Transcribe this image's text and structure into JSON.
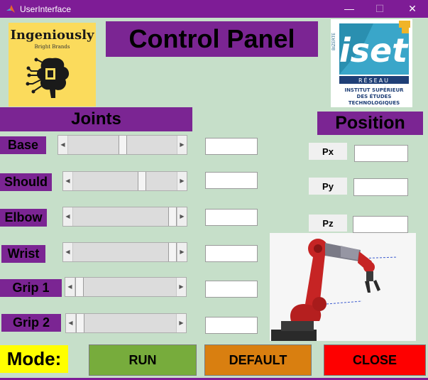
{
  "window": {
    "title": "UserInterface",
    "minimize_symbol": "—",
    "maximize_symbol": "☐",
    "close_symbol": "✕",
    "icon": "matlab-icon"
  },
  "header": {
    "title": "Control Panel"
  },
  "logo_left": {
    "name": "Ingeniously",
    "tagline": "Bright Brands"
  },
  "logo_right": {
    "big": "iset",
    "side": "BIZERTE",
    "reseau": "RÉSEAU",
    "line1": "INSTITUT SUPÉRIEUR",
    "line2": "DES ÉTUDES",
    "line3": "TECHNOLOGIQUES"
  },
  "joints": {
    "title": "Joints",
    "items": [
      {
        "label": "Base",
        "value": 0.5,
        "field": ""
      },
      {
        "label": "Should",
        "value": 0.68,
        "field": ""
      },
      {
        "label": "Elbow",
        "value": 1.0,
        "field": ""
      },
      {
        "label": "Wrist",
        "value": 1.0,
        "field": ""
      },
      {
        "label": "Grip 1",
        "value": 0.0,
        "field": ""
      },
      {
        "label": "Grip 2",
        "value": 0.0,
        "field": ""
      }
    ]
  },
  "position": {
    "title": "Position",
    "items": [
      {
        "label": "Px",
        "field": ""
      },
      {
        "label": "Py",
        "field": ""
      },
      {
        "label": "Pz",
        "field": ""
      }
    ]
  },
  "mode": {
    "label": "Mode:"
  },
  "buttons": {
    "run": "RUN",
    "default": "DEFAULT",
    "close": "CLOSE"
  },
  "colors": {
    "accent": "#7b2593",
    "background": "#c6dfc9",
    "run": "#77ac3c",
    "default": "#d97f10",
    "close": "#fe0000",
    "mode": "#ffff00"
  }
}
